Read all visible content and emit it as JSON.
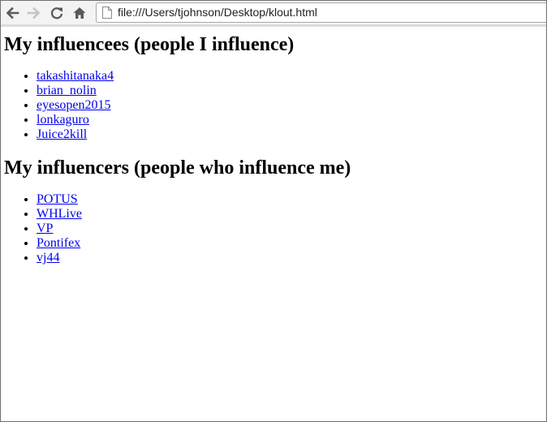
{
  "browser": {
    "url": "file:///Users/tjohnson/Desktop/klout.html",
    "icons": [
      "back-arrow-icon",
      "forward-arrow-icon",
      "reload-icon",
      "home-icon",
      "page-icon"
    ]
  },
  "page": {
    "influencees": {
      "heading": "My influencees (people I influence)",
      "items": [
        "takashitanaka4",
        "brian_nolin",
        "eyesopen2015",
        "lonkaguro",
        "Juice2kill"
      ]
    },
    "influencers": {
      "heading": "My influencers (people who influence me)",
      "items": [
        "POTUS",
        "WHLive",
        "VP",
        "Pontifex",
        "vj44"
      ]
    }
  },
  "colors": {
    "link": "#0000ee",
    "toolbar": "#f3f3f3"
  }
}
